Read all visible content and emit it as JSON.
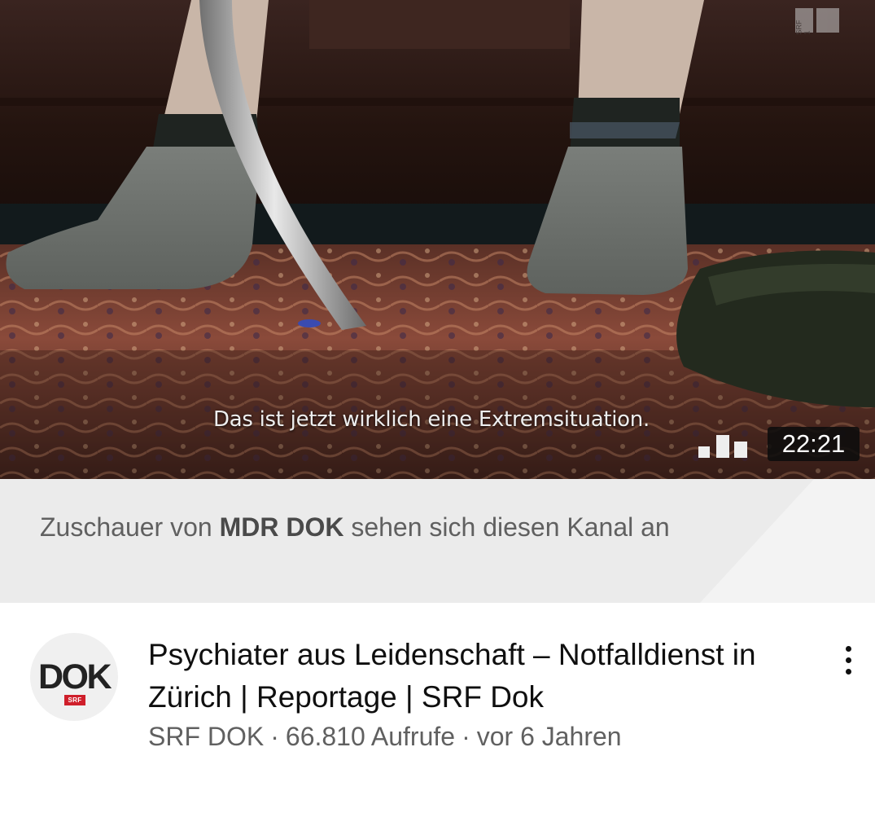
{
  "video": {
    "subtitle": "Das ist jetzt wirklich eine Extremsituation.",
    "duration": "22:21",
    "station_logo_text": "SRF 1"
  },
  "reason": {
    "prefix": "Zuschauer von ",
    "channel": "MDR DOK",
    "suffix": " sehen sich diesen Kanal an"
  },
  "item": {
    "channel_avatar": {
      "main": "DOK",
      "badge": "SRF"
    },
    "title": "Psychiater aus Leidenschaft – Notfalldienst in Zürich | Reportage | SRF Dok",
    "channel_name": "SRF DOK",
    "separator": "·",
    "views": "66.810 Aufrufe",
    "age": "vor 6 Jahren"
  },
  "icons": {
    "quality": "signal-bars-icon",
    "more": "more-vert-icon"
  },
  "colors": {
    "reason_bg": "#ebebeb",
    "srf_red": "#cf1f2b",
    "secondary_text": "#606060"
  }
}
